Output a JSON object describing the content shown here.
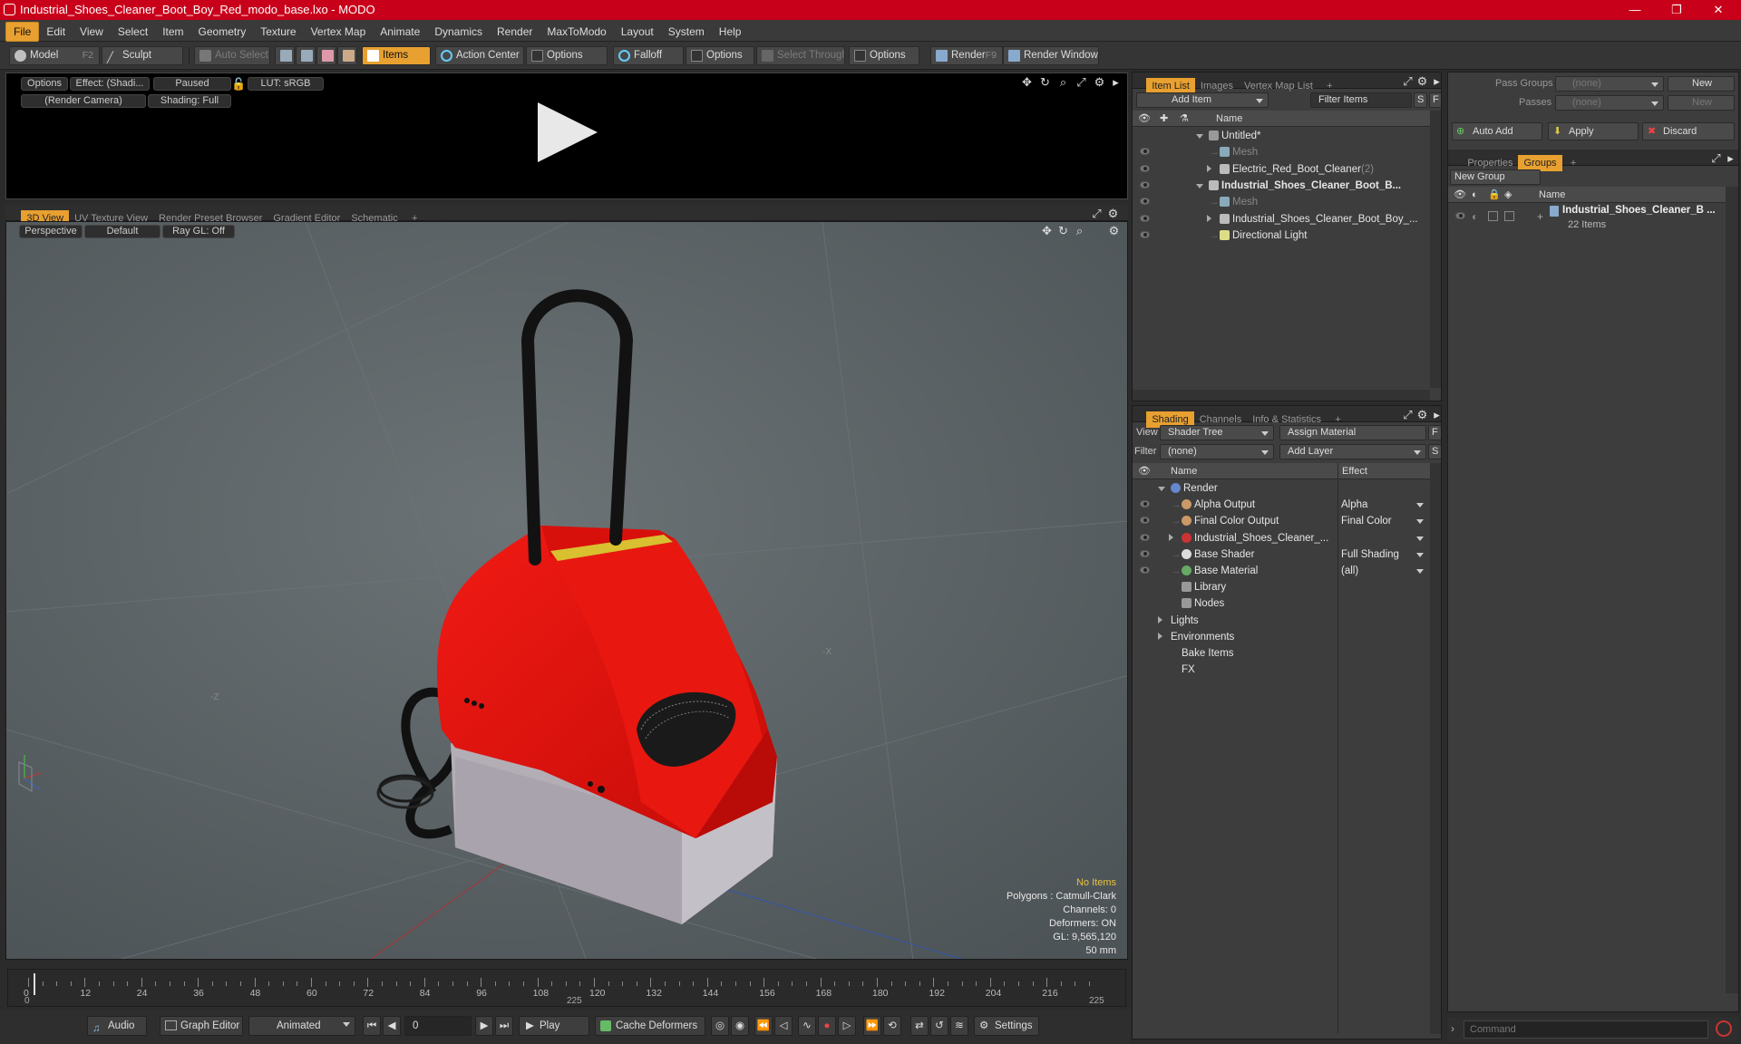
{
  "window": {
    "title": "Industrial_Shoes_Cleaner_Boot_Boy_Red_modo_base.lxo - MODO",
    "min": "—",
    "max": "❐",
    "close": "✕"
  },
  "menu": [
    "File",
    "Edit",
    "View",
    "Select",
    "Item",
    "Geometry",
    "Texture",
    "Vertex Map",
    "Animate",
    "Dynamics",
    "Render",
    "MaxToModo",
    "Layout",
    "System",
    "Help"
  ],
  "toolbar": {
    "model": "Model",
    "model_key": "F2",
    "sculpt": "Sculpt",
    "auto_select": "Auto Select",
    "items": "Items",
    "action_center": "Action Center",
    "options1": "Options",
    "falloff": "Falloff",
    "options2": "Options",
    "select_through": "Select Through",
    "options3": "Options",
    "render": "Render",
    "render_key": "F9",
    "render_window": "Render Window"
  },
  "preview": {
    "options": "Options",
    "effect": "Effect: (Shadi...",
    "paused": "Paused",
    "lut": "LUT: sRGB",
    "camera": "(Render Camera)",
    "shading": "Shading: Full"
  },
  "view_tabs": [
    "3D View",
    "UV Texture View",
    "Render Preset Browser",
    "Gradient Editor",
    "Schematic"
  ],
  "viewport": {
    "perspective": "Perspective",
    "default": "Default",
    "raygl": "Ray GL: Off",
    "label_x": "-X",
    "label_z": "-Z",
    "stats": [
      "No Items",
      "Polygons : Catmull-Clark",
      "Channels: 0",
      "Deformers: ON",
      "GL: 9,565,120",
      "50 mm"
    ]
  },
  "timeline": {
    "ticks": [
      "0",
      "12",
      "24",
      "36",
      "48",
      "60",
      "72",
      "84",
      "96",
      "108",
      "120",
      "132",
      "144",
      "156",
      "168",
      "180",
      "192",
      "204",
      "216"
    ],
    "start": "0",
    "mid": "225",
    "end": "225"
  },
  "bottom": {
    "audio": "Audio",
    "graph_editor": "Graph Editor",
    "animated": "Animated",
    "frame": "0",
    "play": "Play",
    "cache": "Cache Deformers",
    "settings": "Settings"
  },
  "item_list": {
    "tabs": [
      "Item List",
      "Images",
      "Vertex Map List"
    ],
    "add_item": "Add Item",
    "filter": "Filter Items",
    "s": "S",
    "f": "F",
    "col_name": "Name",
    "rows": [
      {
        "label": "Untitled*"
      },
      {
        "label": "Mesh"
      },
      {
        "label": "Electric_Red_Boot_Cleaner",
        "suffix": "(2)"
      },
      {
        "label": "Industrial_Shoes_Cleaner_Boot_B..."
      },
      {
        "label": "Mesh"
      },
      {
        "label": "Industrial_Shoes_Cleaner_Boot_Boy_..."
      },
      {
        "label": "Directional Light"
      }
    ]
  },
  "shading": {
    "tabs": [
      "Shading",
      "Channels",
      "Info & Statistics"
    ],
    "view_label": "View",
    "view_value": "Shader Tree",
    "assign": "Assign Material",
    "f": "F",
    "filter_label": "Filter",
    "filter_value": "(none)",
    "add_layer": "Add Layer",
    "s": "S",
    "col_name": "Name",
    "col_effect": "Effect",
    "rows": [
      {
        "label": "Render",
        "effect": ""
      },
      {
        "label": "Alpha Output",
        "effect": "Alpha"
      },
      {
        "label": "Final Color Output",
        "effect": "Final Color"
      },
      {
        "label": "Industrial_Shoes_Cleaner_...",
        "effect": ""
      },
      {
        "label": "Base Shader",
        "effect": "Full Shading"
      },
      {
        "label": "Base Material",
        "effect": "(all)"
      },
      {
        "label": "Library",
        "effect": ""
      },
      {
        "label": "Nodes",
        "effect": ""
      },
      {
        "label": "Lights",
        "effect": ""
      },
      {
        "label": "Environments",
        "effect": ""
      },
      {
        "label": "Bake Items",
        "effect": ""
      },
      {
        "label": "FX",
        "effect": ""
      }
    ]
  },
  "groups": {
    "pass_groups": "Pass Groups",
    "passes": "Passes",
    "none1": "(none)",
    "none2": "(none)",
    "new1": "New",
    "new2": "New",
    "auto_add": "Auto Add",
    "apply": "Apply",
    "discard": "Discard",
    "tabs": [
      "Properties",
      "Groups"
    ],
    "new_group": "New Group",
    "col_name": "Name",
    "group_name": "Industrial_Shoes_Cleaner_B ...",
    "group_count": "22 Items"
  },
  "command": {
    "placeholder": "Command"
  },
  "colors": {
    "accent": "#e8a030",
    "title": "#c9001a",
    "object_red": "#e0140f"
  }
}
